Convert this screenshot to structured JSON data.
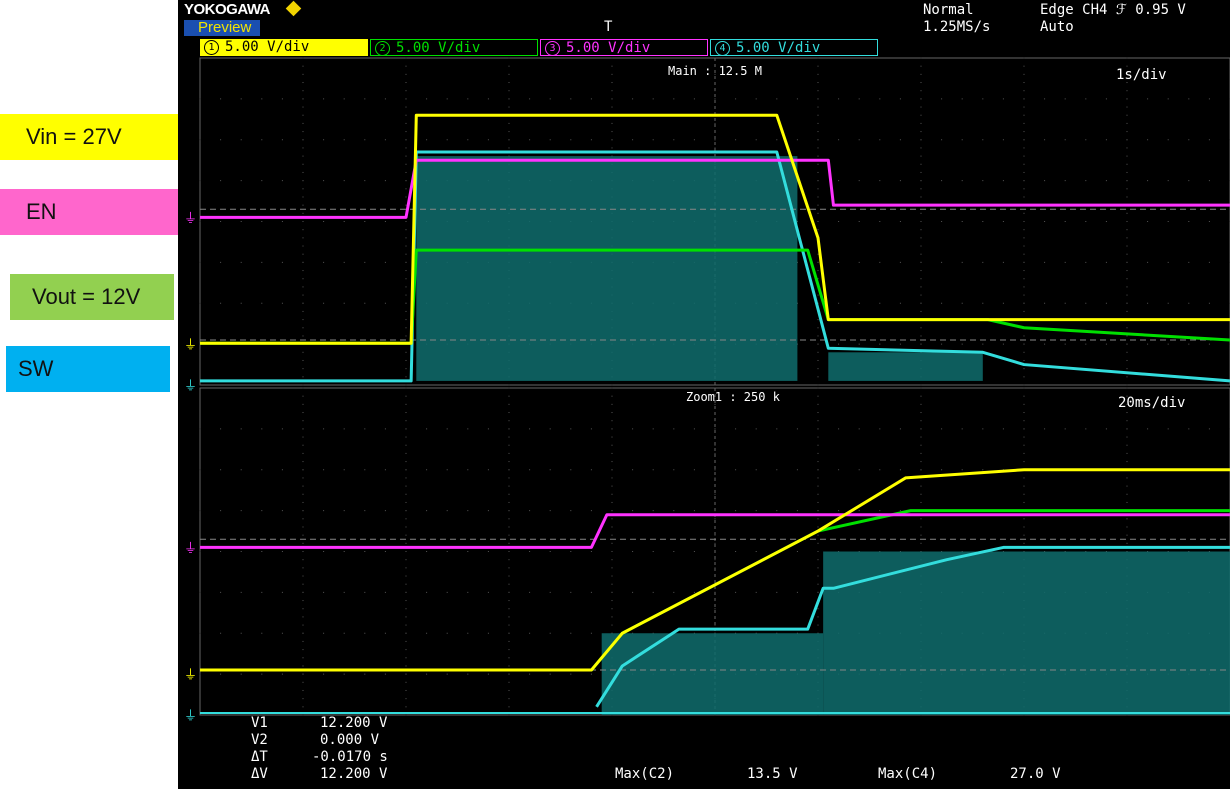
{
  "labels": [
    {
      "text": "Vin = 27V",
      "color": "#ffff00"
    },
    {
      "text": "EN",
      "color": "#ff66cc"
    },
    {
      "text": "Vout = 12V",
      "color": "#92d050"
    },
    {
      "text": "SW",
      "color": "#00b0f0"
    }
  ],
  "header": {
    "brand": "YOKOGAWA",
    "preview": "Preview",
    "trigger_marker": "T",
    "mode": "Normal",
    "sample_rate": "1.25MS/s",
    "trigger_setting": "Edge CH4 ℱ 0.95 V",
    "trigger_mode": "Auto"
  },
  "channels": [
    {
      "num": "1",
      "scale": "5.00 V/div",
      "color": "#ffff00"
    },
    {
      "num": "2",
      "scale": "5.00 V/div",
      "color": "#00e000"
    },
    {
      "num": "3",
      "scale": "5.00 V/div",
      "color": "#ff33ff"
    },
    {
      "num": "4",
      "scale": "5.00 V/div",
      "color": "#33dddd"
    }
  ],
  "main_window": {
    "label": "Main : 12.5 M",
    "timebase": "1s/div"
  },
  "zoom_window": {
    "label": "Zoom1 : 250 k",
    "timebase": "20ms/div"
  },
  "measurements": {
    "v1_label": "V1",
    "v1_value": "12.200 V",
    "v2_label": "V2",
    "v2_value": "0.000 V",
    "dt_label": "ΔT",
    "dt_value": "-0.0170 s",
    "dv_label": "ΔV",
    "dv_value": "12.200 V",
    "max_c2_label": "Max(C2)",
    "max_c2_value": "13.5 V",
    "max_c4_label": "Max(C4)",
    "max_c4_value": "27.0 V"
  },
  "chart_data": [
    {
      "type": "line",
      "title": "Main : 12.5 M",
      "timebase": "1s/div",
      "x_divisions": 10,
      "y_divisions": 8,
      "series": [
        {
          "name": "Vin = 27V",
          "color": "#ffff00",
          "y_div": [
            [
              0,
              1.02
            ],
            [
              2.05,
              1.02
            ],
            [
              2.1,
              6.6
            ],
            [
              5.6,
              6.6
            ],
            [
              6.0,
              3.6
            ],
            [
              6.1,
              1.6
            ],
            [
              10,
              1.6
            ]
          ]
        },
        {
          "name": "EN",
          "color": "#ff33ff",
          "y_div": [
            [
              0,
              4.1
            ],
            [
              2.0,
              4.1
            ],
            [
              2.1,
              5.5
            ],
            [
              6.1,
              5.5
            ],
            [
              6.15,
              4.4
            ],
            [
              10,
              4.4
            ]
          ]
        },
        {
          "name": "Vout = 12V",
          "color": "#00e000",
          "y_div": [
            [
              0,
              1.02
            ],
            [
              2.05,
              1.02
            ],
            [
              2.1,
              3.3
            ],
            [
              5.9,
              3.3
            ],
            [
              6.1,
              1.6
            ],
            [
              7.65,
              1.6
            ],
            [
              8.0,
              1.4
            ],
            [
              10,
              1.1
            ]
          ]
        },
        {
          "name": "SW",
          "color": "#33dddd",
          "y_div": [
            [
              0,
              0.1
            ],
            [
              2.05,
              0.1
            ],
            [
              2.1,
              5.7
            ],
            [
              5.6,
              5.7
            ],
            [
              6.1,
              0.9
            ],
            [
              7.6,
              0.8
            ],
            [
              8.0,
              0.5
            ],
            [
              10,
              0.1
            ]
          ]
        }
      ]
    },
    {
      "type": "line",
      "title": "Zoom1 : 250 k",
      "timebase": "20ms/div",
      "x_divisions": 10,
      "y_divisions": 8,
      "series": [
        {
          "name": "Vin = 27V",
          "color": "#ffff00",
          "y_div": [
            [
              0,
              1.1
            ],
            [
              3.8,
              1.1
            ],
            [
              4.1,
              2.0
            ],
            [
              6.0,
              4.5
            ],
            [
              6.85,
              5.8
            ],
            [
              8.0,
              6.0
            ],
            [
              10,
              6.0
            ]
          ]
        },
        {
          "name": "EN",
          "color": "#ff33ff",
          "y_div": [
            [
              0,
              4.1
            ],
            [
              3.8,
              4.1
            ],
            [
              3.95,
              4.9
            ],
            [
              10,
              4.9
            ]
          ]
        },
        {
          "name": "Vout = 12V",
          "color": "#00e000",
          "y_div": [
            [
              0,
              1.1
            ],
            [
              3.8,
              1.1
            ],
            [
              4.1,
              2.0
            ],
            [
              6.0,
              4.5
            ],
            [
              6.9,
              5.0
            ],
            [
              7.4,
              5.0
            ],
            [
              10,
              5.0
            ]
          ]
        },
        {
          "name": "SW",
          "color": "#33dddd",
          "y_div": [
            [
              3.85,
              0.2
            ],
            [
              4.1,
              1.2
            ],
            [
              4.65,
              2.1
            ],
            [
              4.95,
              2.1
            ],
            [
              5.9,
              2.1
            ],
            [
              6.05,
              3.1
            ],
            [
              6.15,
              3.1
            ],
            [
              7.25,
              3.8
            ],
            [
              7.8,
              4.1
            ],
            [
              10,
              4.1
            ]
          ]
        }
      ]
    }
  ]
}
